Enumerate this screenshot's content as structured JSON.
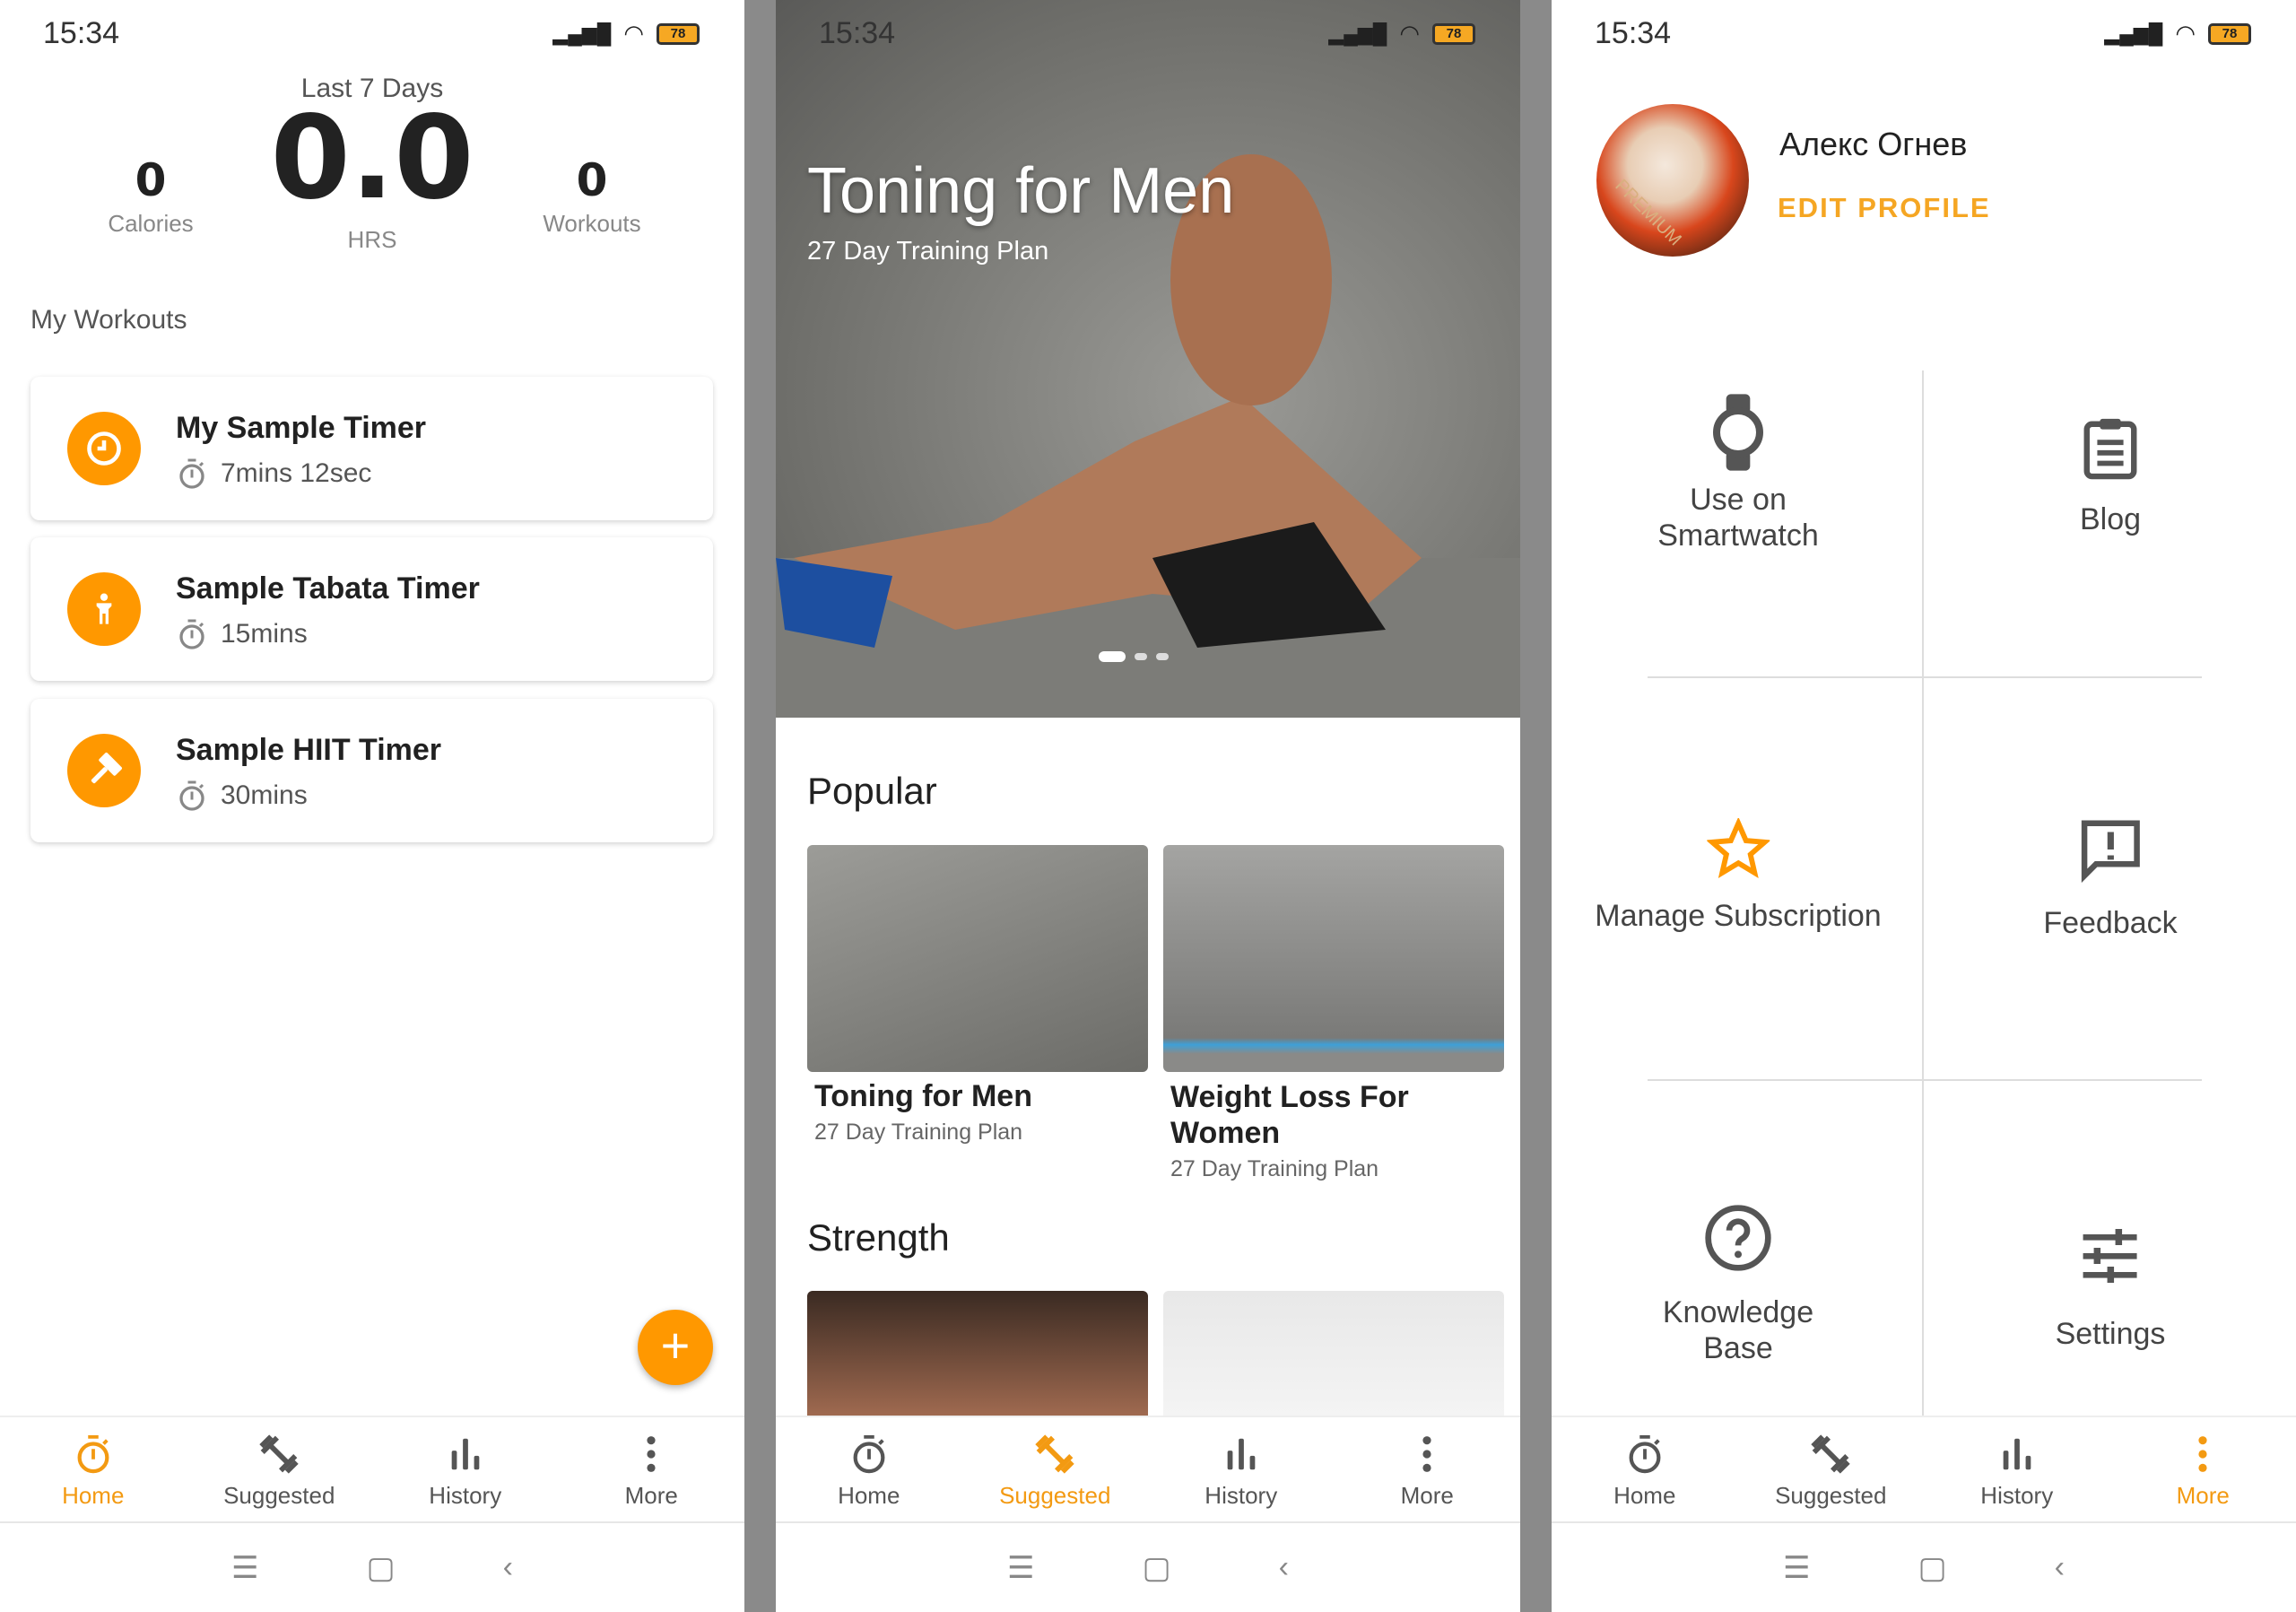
{
  "status": {
    "time": "15:34",
    "battery": "78"
  },
  "home": {
    "period": "Last 7 Days",
    "hours": "0.0",
    "hours_label": "HRS",
    "calories": "0",
    "calories_label": "Calories",
    "workouts": "0",
    "workouts_label": "Workouts",
    "section": "My Workouts",
    "items": [
      {
        "title": "My Sample Timer",
        "duration": "7mins 12sec",
        "icon": "clock-icon"
      },
      {
        "title": "Sample Tabata Timer",
        "duration": "15mins",
        "icon": "person-icon"
      },
      {
        "title": "Sample HIIT Timer",
        "duration": "30mins",
        "icon": "hammer-icon"
      }
    ],
    "fab": "+"
  },
  "suggested": {
    "hero_title": "Toning for Men",
    "hero_subtitle": "27 Day Training Plan",
    "popular": "Popular",
    "popular_items": [
      {
        "title": "Toning for Men",
        "subtitle": "27 Day Training Plan"
      },
      {
        "title": "Weight Loss For Women",
        "subtitle": "27 Day Training Plan"
      }
    ],
    "strength": "Strength"
  },
  "more": {
    "name": "Алекс Огнев",
    "edit": "EDIT PROFILE",
    "avatar_badge": "PREMIUM",
    "items": [
      "Use on Smartwatch",
      "Blog",
      "Manage Subscription",
      "Feedback",
      "Knowledge Base",
      "Settings"
    ]
  },
  "nav": {
    "home": "Home",
    "suggested": "Suggested",
    "history": "History",
    "more": "More"
  },
  "colors": {
    "accent": "#FF9800",
    "text": "#212121"
  }
}
